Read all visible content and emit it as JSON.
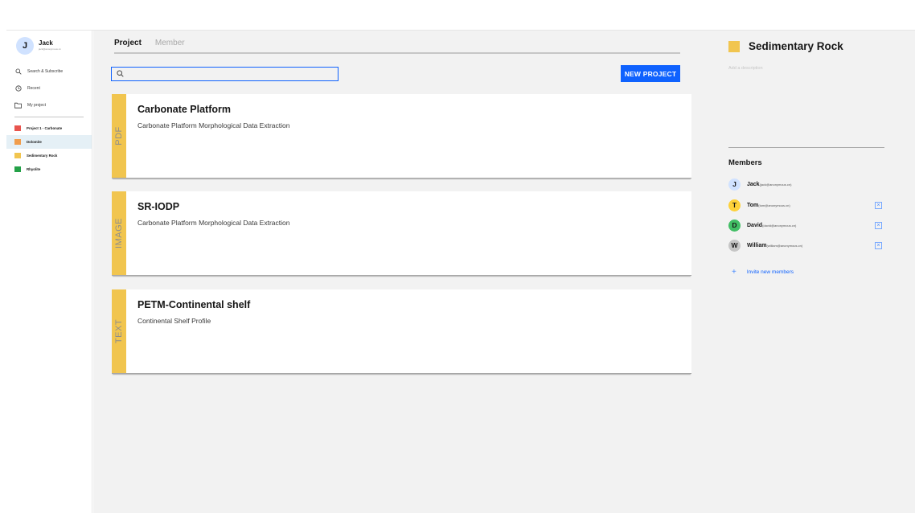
{
  "user": {
    "initial": "J",
    "name": "Jack",
    "email": "jack@anonymous.cn"
  },
  "nav": [
    {
      "label": "Search & Subscribe",
      "icon": "search-icon"
    },
    {
      "label": "Recent",
      "icon": "clock-icon"
    },
    {
      "label": "My project",
      "icon": "folder-icon"
    }
  ],
  "projects": [
    {
      "label": "Project 1 - Carbonate",
      "color": "#e8544e"
    },
    {
      "label": "Dolomite",
      "color": "#f19d4c"
    },
    {
      "label": "Sedimentary Rock",
      "color": "#f1c54f"
    },
    {
      "label": "Rhyolite",
      "color": "#24a148"
    }
  ],
  "tabs": [
    "Project",
    "Member"
  ],
  "search": {
    "value": "",
    "placeholder": ""
  },
  "new_project_label": "NEW PROJECT",
  "cards": [
    {
      "type": "PDF",
      "title": "Carbonate Platform",
      "description": "Carbonate Platform Morphological Data Extraction"
    },
    {
      "type": "IMAGE",
      "title": "SR-IODP",
      "description": "Carbonate Platform Morphological Data Extraction"
    },
    {
      "type": "TEXT",
      "title": "PETM-Continental shelf",
      "description": "Continental Shelf Profile"
    }
  ],
  "panel": {
    "title": "Sedimentary Rock",
    "color": "#f1c54f",
    "description_placeholder": "Add a description",
    "members_title": "Members",
    "members": [
      {
        "initial": "J",
        "name": "Jack",
        "email": "(jack@anonymous.cn)",
        "color": "#d0e2ff"
      },
      {
        "initial": "T",
        "name": "Tom",
        "email": "(tom@anonymous.cn)",
        "color": "#fdd13a"
      },
      {
        "initial": "D",
        "name": "David",
        "email": "(david@anonymous.cn)",
        "color": "#42be65"
      },
      {
        "initial": "W",
        "name": "William",
        "email": "(william@anonymous.cn)",
        "color": "#c6c6c6"
      }
    ],
    "remove_icon": "×",
    "invite_label": "Invite new members"
  }
}
